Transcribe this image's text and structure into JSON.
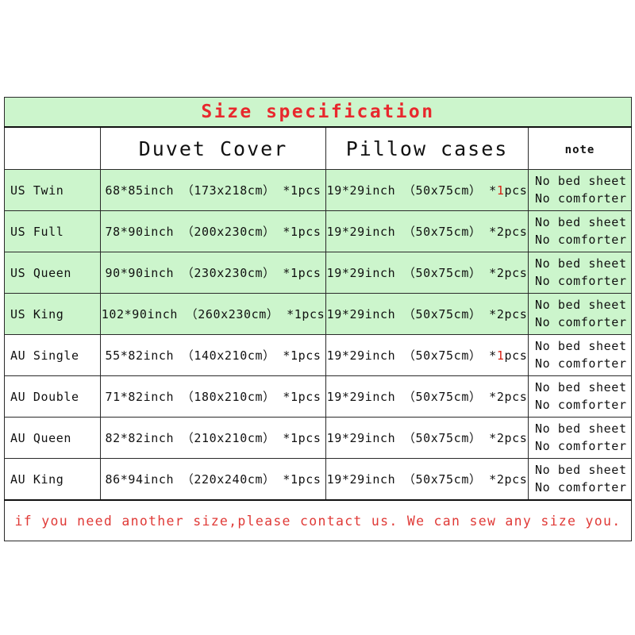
{
  "table": {
    "title": "Size specification",
    "columns": [
      {
        "key": "label",
        "header": ""
      },
      {
        "key": "duvet",
        "header": "Duvet Cover"
      },
      {
        "key": "pillow",
        "header": "Pillow cases"
      },
      {
        "key": "note",
        "header": "note"
      }
    ],
    "rows": [
      {
        "label": "US Twin",
        "duvet": "68*85inch （173x218cm） *1pcs",
        "pillow_prefix": "19*29inch （50x75cm） *",
        "pillow_count": "1",
        "pillow_suffix": "pcs",
        "pillow_count_highlighted": true,
        "note_line1": "No bed sheet",
        "note_line2": "No comforter",
        "shade": "green"
      },
      {
        "label": "US Full",
        "duvet": "78*90inch （200x230cm） *1pcs",
        "pillow_prefix": "19*29inch （50x75cm） *",
        "pillow_count": "2",
        "pillow_suffix": "pcs",
        "pillow_count_highlighted": false,
        "note_line1": "No bed sheet",
        "note_line2": "No comforter",
        "shade": "green"
      },
      {
        "label": "US Queen",
        "duvet": "90*90inch （230x230cm） *1pcs",
        "pillow_prefix": "19*29inch （50x75cm） *",
        "pillow_count": "2",
        "pillow_suffix": "pcs",
        "pillow_count_highlighted": false,
        "note_line1": "No bed sheet",
        "note_line2": "No comforter",
        "shade": "green"
      },
      {
        "label": "US King",
        "duvet": "102*90inch （260x230cm） *1pcs",
        "pillow_prefix": "19*29inch （50x75cm） *",
        "pillow_count": "2",
        "pillow_suffix": "pcs",
        "pillow_count_highlighted": false,
        "note_line1": "No bed sheet",
        "note_line2": "No comforter",
        "shade": "green"
      },
      {
        "label": "AU Single",
        "duvet": "55*82inch （140x210cm） *1pcs",
        "pillow_prefix": "19*29inch （50x75cm） *",
        "pillow_count": "1",
        "pillow_suffix": "pcs",
        "pillow_count_highlighted": true,
        "note_line1": "No bed sheet",
        "note_line2": "No comforter",
        "shade": "white"
      },
      {
        "label": "AU Double",
        "duvet": "71*82inch （180x210cm） *1pcs",
        "pillow_prefix": "19*29inch （50x75cm） *",
        "pillow_count": "2",
        "pillow_suffix": "pcs",
        "pillow_count_highlighted": false,
        "note_line1": "No bed sheet",
        "note_line2": "No comforter",
        "shade": "white"
      },
      {
        "label": "AU Queen",
        "duvet": "82*82inch （210x210cm） *1pcs",
        "pillow_prefix": "19*29inch （50x75cm） *",
        "pillow_count": "2",
        "pillow_suffix": "pcs",
        "pillow_count_highlighted": false,
        "note_line1": "No bed sheet",
        "note_line2": "No comforter",
        "shade": "white"
      },
      {
        "label": "AU King",
        "duvet": "86*94inch （220x240cm） *1pcs",
        "pillow_prefix": "19*29inch （50x75cm） *",
        "pillow_count": "2",
        "pillow_suffix": "pcs",
        "pillow_count_highlighted": false,
        "note_line1": "No bed sheet",
        "note_line2": "No comforter",
        "shade": "white"
      }
    ],
    "footer": "if you need another size,please contact us. We can sew any size you."
  },
  "colors": {
    "row_green": "#ccf5cc",
    "row_white": "#ffffff",
    "title_red": "#e8282d",
    "footer_red": "#e03a37",
    "highlight_red": "#d81f12",
    "border": "#2a2a2a",
    "text": "#111111"
  }
}
